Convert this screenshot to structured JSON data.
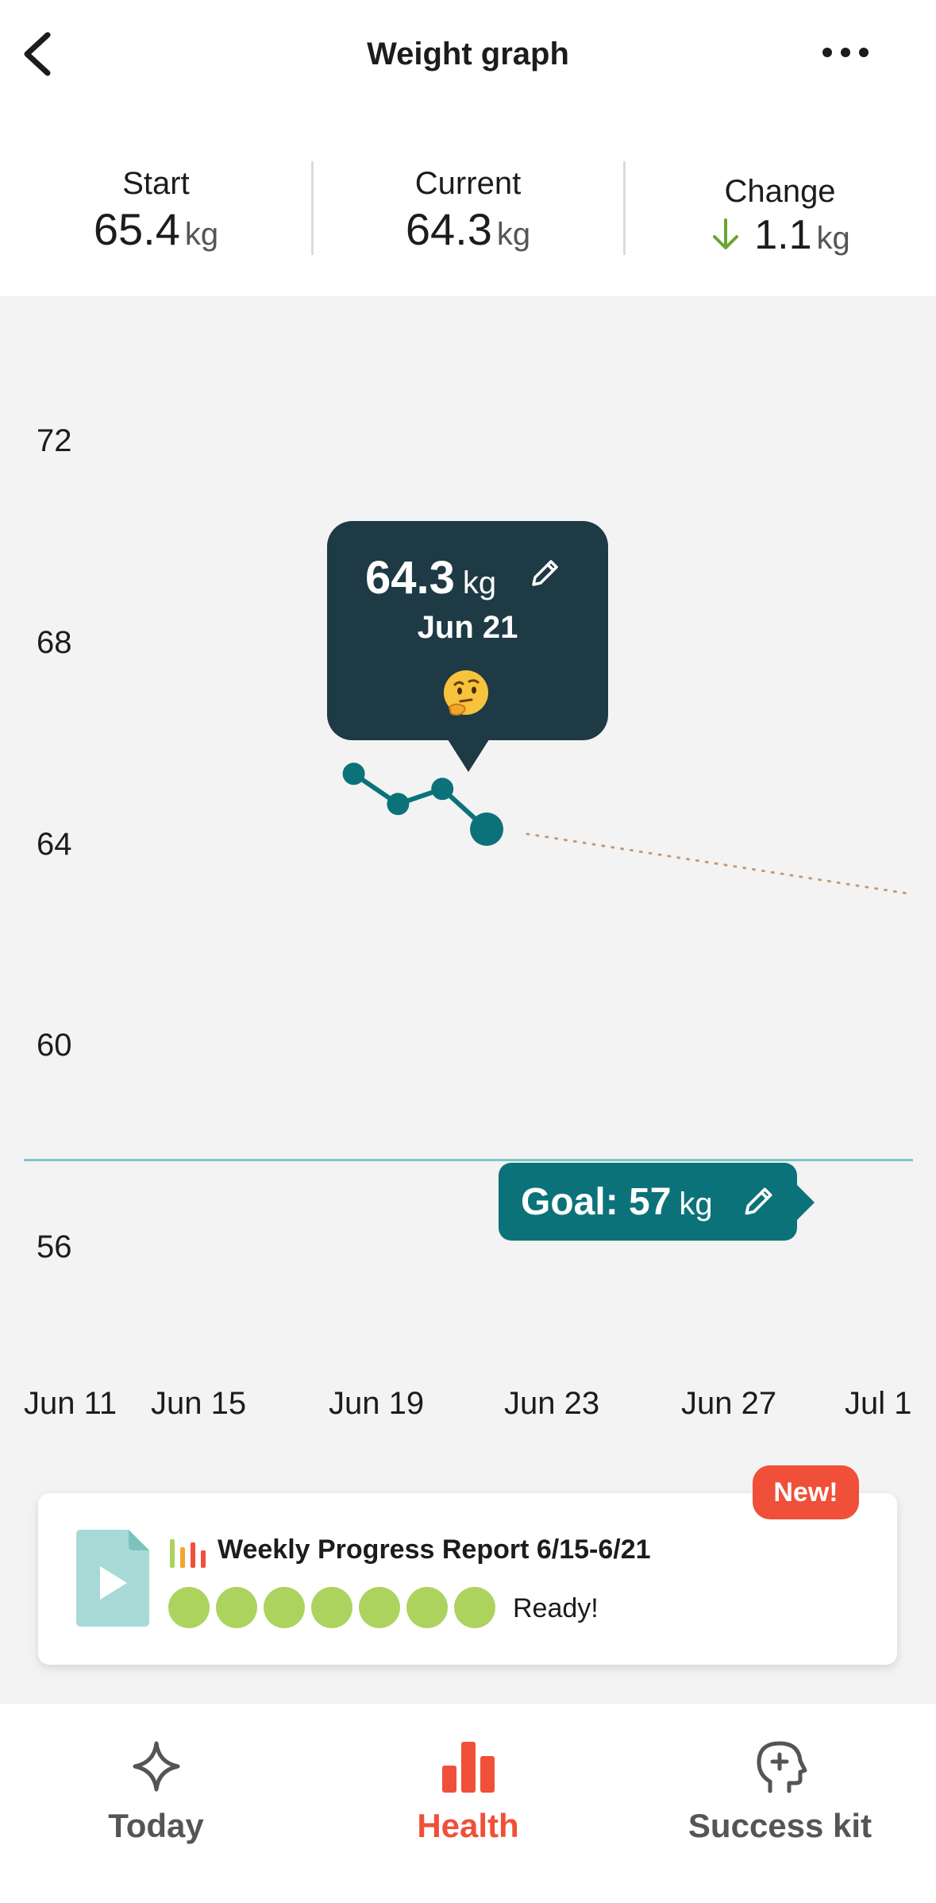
{
  "header": {
    "title": "Weight graph",
    "back_icon": "chevron-left-icon",
    "more_icon": "more-horizontal-icon"
  },
  "stats": {
    "start": {
      "label": "Start",
      "value": "65.4",
      "unit": "kg"
    },
    "current": {
      "label": "Current",
      "value": "64.3",
      "unit": "kg"
    },
    "change": {
      "label": "Change",
      "value": "1.1",
      "unit": "kg",
      "direction": "down",
      "arrow_icon": "arrow-down-icon"
    }
  },
  "chart_data": {
    "type": "line",
    "y_ticks": [
      "72",
      "68",
      "64",
      "60",
      "56"
    ],
    "x_ticks": [
      "Jun 11",
      "Jun 15",
      "Jun 19",
      "Jun 23",
      "Jun 27",
      "Jul 1"
    ],
    "ylim": [
      54,
      74
    ],
    "series": [
      {
        "x": [
          "Jun 18",
          "Jun 19",
          "Jun 20",
          "Jun 21"
        ],
        "y": [
          65.4,
          64.8,
          65.1,
          64.3
        ]
      }
    ],
    "trend": {
      "x": [
        "Jun 21",
        "Jul 1"
      ],
      "y": [
        64.3,
        63.1
      ],
      "style": "dotted"
    },
    "goal": 57,
    "grid": false
  },
  "tooltip": {
    "value": "64.3",
    "unit": "kg",
    "date": "Jun 21",
    "emoji": "thinking-face-emoji",
    "edit_icon": "pencil-icon"
  },
  "goal": {
    "label": "Goal: 57",
    "unit": "kg",
    "edit_icon": "pencil-icon"
  },
  "report": {
    "badge": "New!",
    "title": "Weekly Progress Report 6/15-6/21",
    "status": "Ready!",
    "days_complete": 7,
    "icon": "document-play-icon",
    "bars_icon": "bar-chart-icon"
  },
  "nav": {
    "items": [
      {
        "label": "Today",
        "icon": "sparkle-icon",
        "active": false
      },
      {
        "label": "Health",
        "icon": "bar-chart-icon",
        "active": true
      },
      {
        "label": "Success kit",
        "icon": "head-plus-icon",
        "active": false
      }
    ]
  },
  "colors": {
    "teal": "#0c727a",
    "dark_tooltip": "#1e3a44",
    "accent_red": "#f04f39",
    "green_dot": "#acd35e",
    "chart_bg": "#f3f3f3",
    "trend_dots": "#c29a7a",
    "goal_line": "#7ec6c9",
    "arrow_green": "#6aa533"
  }
}
